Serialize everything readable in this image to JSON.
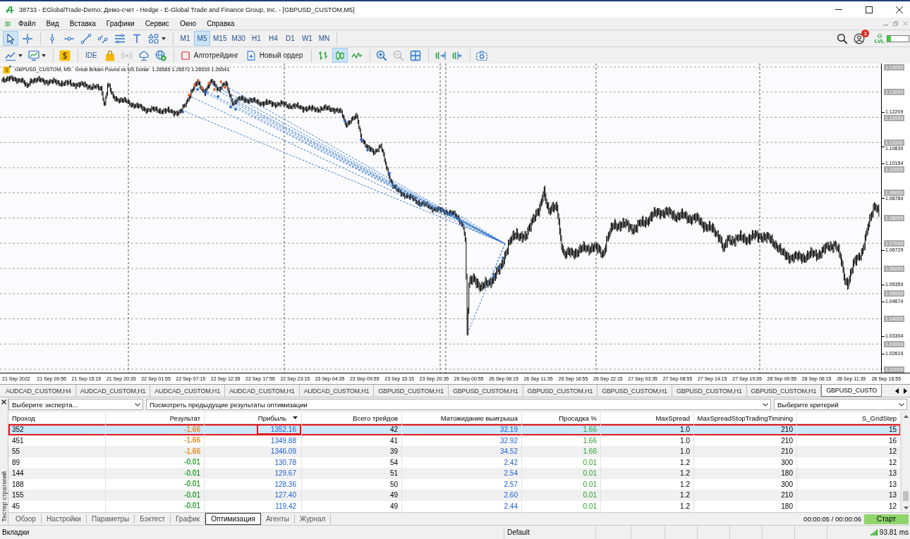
{
  "window": {
    "title": "38733 - EGlobalTrade-Demo: Демо-счет - Hedge - E-Global Trade and Finance Group, Inc. - [GBPUSD_CUSTOM,M5]"
  },
  "menu": {
    "items": [
      "Файл",
      "Вид",
      "Вставка",
      "Графики",
      "Сервис",
      "Окно",
      "Справка"
    ]
  },
  "toolbar": {
    "tools": [
      {
        "kind": "cursor",
        "selected": true
      },
      {
        "kind": "crosshair",
        "selected": false
      },
      {
        "kind": "vline",
        "selected": false
      },
      {
        "kind": "hline",
        "selected": false
      },
      {
        "kind": "trendline",
        "selected": false
      },
      {
        "kind": "channel",
        "selected": false
      },
      {
        "kind": "fibo",
        "selected": false
      },
      {
        "kind": "text",
        "selected": false
      },
      {
        "kind": "shapes",
        "selected": false
      }
    ],
    "timeframes": [
      {
        "label": "M1",
        "selected": false
      },
      {
        "label": "M5",
        "selected": true
      },
      {
        "label": "M15",
        "selected": false
      },
      {
        "label": "M30",
        "selected": false
      },
      {
        "label": "H1",
        "selected": false
      },
      {
        "label": "H4",
        "selected": false
      },
      {
        "label": "D1",
        "selected": false
      },
      {
        "label": "W1",
        "selected": false
      },
      {
        "label": "MN",
        "selected": false
      }
    ],
    "notifications": "1",
    "level_label": "LVL",
    "level": 0.17
  },
  "toolbar2": {
    "tools": [
      {
        "kind": "indicators",
        "disabled": false
      },
      {
        "kind": "templates",
        "disabled": false
      },
      {
        "kind": "market",
        "disabled": false
      },
      {
        "kind": "ide",
        "label": "IDE",
        "disabled": false
      },
      {
        "kind": "shop",
        "disabled": false
      },
      {
        "kind": "signals",
        "disabled": true
      },
      {
        "kind": "cloud",
        "disabled": false
      },
      {
        "kind": "vps",
        "disabled": false
      }
    ],
    "algo_trading": {
      "label": "Алготрейдинг",
      "on": false
    },
    "new_order": {
      "label": "Новый ордер"
    },
    "chart_types": [
      {
        "kind": "bars",
        "selected": false
      },
      {
        "kind": "candles",
        "selected": true
      },
      {
        "kind": "line",
        "selected": false
      }
    ],
    "view_tools": [
      {
        "kind": "zoom_in",
        "disabled": false
      },
      {
        "kind": "zoom_out",
        "disabled": true
      },
      {
        "kind": "grid",
        "disabled": false
      },
      {
        "kind": "shift",
        "disabled": false
      },
      {
        "kind": "autoscroll",
        "disabled": false
      },
      {
        "kind": "screenshot",
        "disabled": false
      }
    ]
  },
  "chart": {
    "symbol": "GBPUSD_CUSTOM, M5:",
    "description": "Great Britain Pound vs US Dollar",
    "quotes": "1.26565 1.26572 1.26539 1.26541",
    "price_labels": [
      {
        "text": "1.14000",
        "kind": "level"
      },
      {
        "text": "1.13000",
        "kind": "level"
      },
      {
        "text": "1.12209",
        "kind": "tick"
      },
      {
        "text": "1.12000",
        "kind": "level"
      },
      {
        "text": "1.11000",
        "kind": "level"
      },
      {
        "text": "1.10839",
        "kind": "tick"
      },
      {
        "text": "1.10154",
        "kind": "tick"
      },
      {
        "text": "1.10000",
        "kind": "level"
      },
      {
        "text": "1.09000",
        "kind": "level"
      },
      {
        "text": "1.08784",
        "kind": "tick"
      },
      {
        "text": "1.08000",
        "kind": "level"
      },
      {
        "text": "1.07000",
        "kind": "level"
      },
      {
        "text": "1.06729",
        "kind": "tick"
      },
      {
        "text": "1.06000",
        "kind": "level"
      },
      {
        "text": "1.05359",
        "kind": "tick"
      },
      {
        "text": "1.05000",
        "kind": "level"
      },
      {
        "text": "1.04674",
        "kind": "tick"
      },
      {
        "text": "1.04000",
        "kind": "level"
      },
      {
        "text": "1.03304",
        "kind": "tick"
      },
      {
        "text": "1.03000",
        "kind": "level"
      },
      {
        "text": "1.02619",
        "kind": "tick"
      },
      {
        "text": "1.02000",
        "kind": "level"
      }
    ],
    "time_labels": [
      "21 Sep 2022",
      "21 Sep 09:55",
      "21 Sep 15:15",
      "21 Sep 20:35",
      "22 Sep 01:55",
      "22 Sep 07:15",
      "22 Sep 12:35",
      "22 Sep 17:55",
      "22 Sep 23:15",
      "23 Sep 04:35",
      "23 Sep 09:55",
      "23 Sep 15:15",
      "23 Sep 20:35",
      "26 Sep 00:55",
      "26 Sep 06:15",
      "26 Sep 11:35",
      "26 Sep 16:55",
      "26 Sep 22:15",
      "27 Sep 03:35",
      "27 Sep 08:55",
      "27 Sep 14:15",
      "27 Sep 19:35",
      "28 Sep 00:55",
      "28 Sep 06:15",
      "28 Sep 11:35",
      "28 Sep 16:55"
    ]
  },
  "chart_tabs": [
    {
      "label": "AUDCAD_CUSTOM,H4",
      "selected": false
    },
    {
      "label": "AUDCAD_CUSTOM,H1",
      "selected": false
    },
    {
      "label": "AUDCAD_CUSTOM,H1",
      "selected": false
    },
    {
      "label": "AUDCAD_CUSTOM,H1",
      "selected": false
    },
    {
      "label": "AUDCAD_CUSTOM,H1",
      "selected": false
    },
    {
      "label": "GBPUSD_CUSTOM,H1",
      "selected": false
    },
    {
      "label": "GBPUSD_CUSTOM,H1",
      "selected": false
    },
    {
      "label": "GBPUSD_CUSTOM,H1",
      "selected": false
    },
    {
      "label": "GBPUSD_CUSTOM,H1",
      "selected": false
    },
    {
      "label": "GBPUSD_CUSTOM,H1",
      "selected": false
    },
    {
      "label": "GBPUSD_CUSTOM,H1",
      "selected": false
    },
    {
      "label": "GBPUSD_CUSTO",
      "selected": true
    }
  ],
  "tester": {
    "title": "Тестер стратегий",
    "expert": "Выберите эксперта...",
    "history": "Посмотреть предыдущие результаты оптимизации",
    "criterion": "Выберите критерий",
    "columns": [
      {
        "label": "Проход",
        "sorted": false
      },
      {
        "label": "Результат",
        "sorted": false
      },
      {
        "label": "Прибыль",
        "sorted": true
      },
      {
        "label": "Всего трейдов",
        "sorted": false
      },
      {
        "label": "Матожидание выигрыша",
        "sorted": false
      },
      {
        "label": "Просадка %",
        "sorted": false
      },
      {
        "label": "MaxSpread",
        "sorted": false
      },
      {
        "label": "MaxSpreadStopTradingTimining",
        "sorted": false
      },
      {
        "label": "S_GridStep",
        "sorted": false
      }
    ],
    "rows": [
      {
        "cells": [
          "352",
          "-1.66",
          "1352.16",
          "42",
          "32.19",
          "1.66",
          "1.0",
          "210",
          "15"
        ],
        "color": "#e6891e",
        "selected": true,
        "outlined": true,
        "profit_outlined": true
      },
      {
        "cells": [
          "451",
          "-1.66",
          "1349.88",
          "41",
          "32.92",
          "1.66",
          "1.0",
          "210",
          "16"
        ],
        "color": "#e6891e",
        "selected": false,
        "outlined": false,
        "profit_outlined": false
      },
      {
        "cells": [
          "55",
          "-1.66",
          "1346.09",
          "39",
          "34.52",
          "1.66",
          "1.0",
          "210",
          "12"
        ],
        "color": "#e6891e",
        "selected": false,
        "outlined": false,
        "profit_outlined": false
      },
      {
        "cells": [
          "89",
          "-0.01",
          "130.78",
          "54",
          "2.42",
          "0.01",
          "1.2",
          "300",
          "12"
        ],
        "color": "#2ca02c",
        "selected": false,
        "outlined": false,
        "profit_outlined": false
      },
      {
        "cells": [
          "144",
          "-0.01",
          "129.67",
          "51",
          "2.54",
          "0.01",
          "1.2",
          "180",
          "13"
        ],
        "color": "#2ca02c",
        "selected": false,
        "outlined": false,
        "profit_outlined": false
      },
      {
        "cells": [
          "188",
          "-0.01",
          "128.36",
          "50",
          "2.57",
          "0.01",
          "1.2",
          "300",
          "13"
        ],
        "color": "#2ca02c",
        "selected": false,
        "outlined": false,
        "profit_outlined": false
      },
      {
        "cells": [
          "155",
          "-0.01",
          "127.40",
          "49",
          "2.60",
          "0.01",
          "1.2",
          "210",
          "13"
        ],
        "color": "#2ca02c",
        "selected": false,
        "outlined": false,
        "profit_outlined": false
      },
      {
        "cells": [
          "45",
          "-0.01",
          "119.42",
          "49",
          "2.44",
          "0.01",
          "1.2",
          "180",
          "12"
        ],
        "color": "#2ca02c",
        "selected": false,
        "outlined": false,
        "profit_outlined": false
      }
    ],
    "tabs": [
      {
        "label": "Обзор",
        "selected": false
      },
      {
        "label": "Настройки",
        "selected": false
      },
      {
        "label": "Параметры",
        "selected": false
      },
      {
        "label": "Бэктест",
        "selected": false
      },
      {
        "label": "График",
        "selected": false
      },
      {
        "label": "Оптимизация",
        "selected": true
      },
      {
        "label": "Агенты",
        "selected": false
      },
      {
        "label": "Журнал",
        "selected": false
      }
    ],
    "elapsed": "00:00:05 / 00:00:06",
    "start": "Старт"
  },
  "status_bar": {
    "hint": "Вкладки",
    "profile": "Default",
    "ping": "93.81 ms"
  }
}
